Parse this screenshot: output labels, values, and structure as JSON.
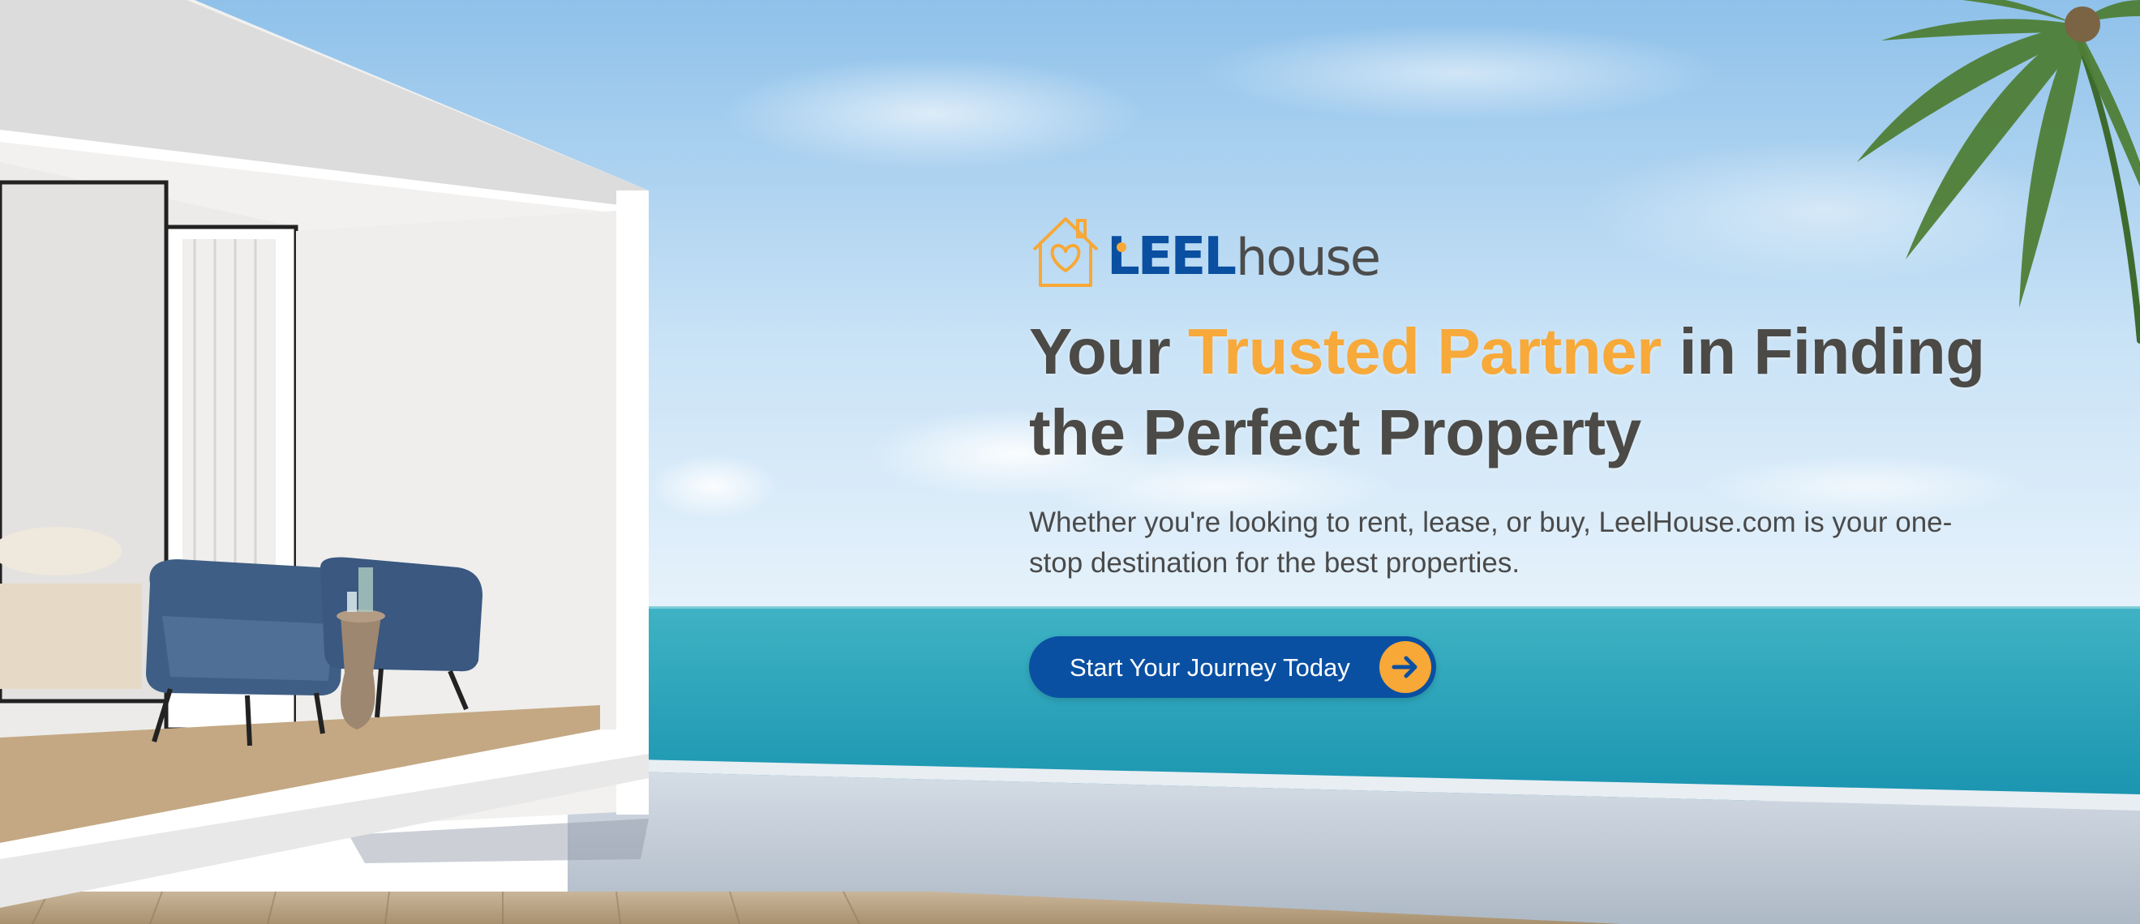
{
  "brand": {
    "logo_mark": "house-heart-icon",
    "logo_leel": "LEEL",
    "logo_house": "house"
  },
  "hero": {
    "headline_pre": "Your ",
    "headline_accent": "Trusted Partner",
    "headline_post": " in Finding the Perfect Property",
    "subtitle": "Whether you're looking to rent, lease, or buy, LeelHouse.com is your one-stop destination for the best properties.",
    "cta_label": "Start Your Journey Today",
    "cta_icon": "arrow-right-icon"
  },
  "colors": {
    "brand_blue": "#0A50A2",
    "accent_orange": "#F7A836",
    "headline_text": "#4C4A46"
  }
}
